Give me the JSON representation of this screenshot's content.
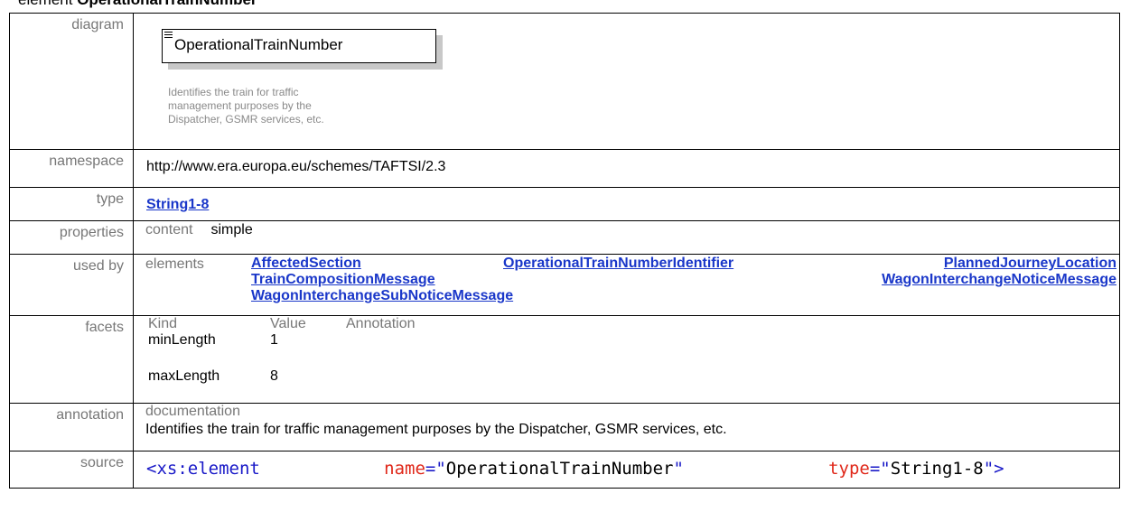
{
  "heading": {
    "prefix": "element ",
    "name": "OperationalTrainNumber"
  },
  "rows": {
    "diagram": {
      "label": "diagram",
      "element_name": "OperationalTrainNumber",
      "note": "Identifies the train for traffic management purposes by the Dispatcher, GSMR services, etc."
    },
    "namespace": {
      "label": "namespace",
      "value": "http://www.era.europa.eu/schemes/TAFTSI/2.3"
    },
    "type": {
      "label": "type",
      "value": "String1-8"
    },
    "properties": {
      "label": "properties",
      "key": "content",
      "value": "simple"
    },
    "used_by": {
      "label": "used by",
      "key": "elements",
      "items": [
        "AffectedSection",
        "OperationalTrainNumberIdentifier",
        "PlannedJourneyLocation",
        "TrainCompositionMessage",
        "WagonInterchangeNoticeMessage",
        "WagonInterchangeSubNoticeMessage"
      ]
    },
    "facets": {
      "label": "facets",
      "headers": [
        "Kind",
        "Value",
        "Annotation"
      ],
      "rows": [
        {
          "kind": "minLength",
          "value": "1"
        },
        {
          "kind": "maxLength",
          "value": "8"
        }
      ]
    },
    "annotation": {
      "label": "annotation",
      "key": "documentation",
      "text": "Identifies the train for traffic management purposes by the Dispatcher, GSMR services, etc."
    },
    "source": {
      "label": "source",
      "tag": "<xs:element",
      "attr1": "name",
      "val1": "OperationalTrainNumber",
      "attr2": "type",
      "val2": "String1-8",
      "close": ">"
    }
  }
}
